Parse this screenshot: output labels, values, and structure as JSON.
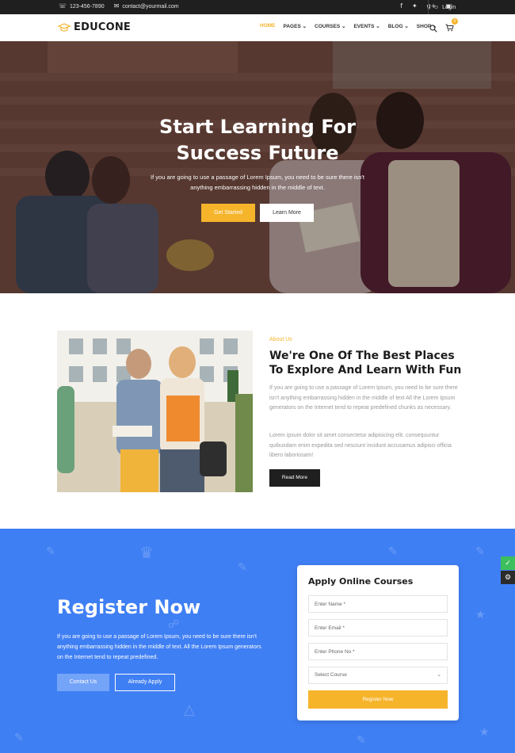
{
  "topbar": {
    "phone": "123-456-7890",
    "email": "contact@yourmail.com",
    "social": [
      "f",
      "t",
      "g+",
      "ig"
    ],
    "login": "Login"
  },
  "header": {
    "logo": "EDUCONE",
    "nav": [
      {
        "label": "HOME",
        "active": true
      },
      {
        "label": "PAGES",
        "active": false
      },
      {
        "label": "COURSES",
        "active": false
      },
      {
        "label": "EVENTS",
        "active": false
      },
      {
        "label": "BLOG",
        "active": false
      },
      {
        "label": "SHOP",
        "active": false
      }
    ],
    "cart_count": "0"
  },
  "hero": {
    "title_line1": "Start Learning For",
    "title_line2": "Success Future",
    "text": "If you are going to use a passage of Lorem Ipsum, you need to be sure there isn't anything embarrassing hidden in the middle of text.",
    "btn_start": "Get Started",
    "btn_learn": "Learn More"
  },
  "about": {
    "subtitle": "About Us",
    "title": "We're One Of The Best Places To Explore And Learn With Fun",
    "p1": "If you are going to use a passage of Lorem Ipsum, you need to be sure there isn't anything embarrassing hidden in the middle of text All the Lorem Ipsum generators on the Internet tend to repeat predefined chunks as necessary.",
    "p2": "Lorem ipsum dolor sit amet consectetur adipisicing elit. consequuntur quibusdam enim expedita sed nesciunt incidunt accusamus adipisci officia libero laboriosam!",
    "btn_read": "Read More"
  },
  "register": {
    "title": "Register Now",
    "text": "If you are going to use a passage of Lorem Ipsum, you need to be sure there isn't anything embarrassing hidden in the middle of text. All the Lorem Ipsum generators on the Internet tend to repeat predefined.",
    "btn_contact": "Contact Us",
    "btn_apply": "Already Apply"
  },
  "form": {
    "title": "Apply Online Courses",
    "name_placeholder": "Enter Name *",
    "email_placeholder": "Enter Email *",
    "phone_placeholder": "Enter Phone No *",
    "course_select": "Select Course",
    "submit": "Register Now"
  },
  "colors": {
    "accent": "#f6b42b",
    "register_bg": "#3f7ff4",
    "dark": "#1f1f1f"
  }
}
